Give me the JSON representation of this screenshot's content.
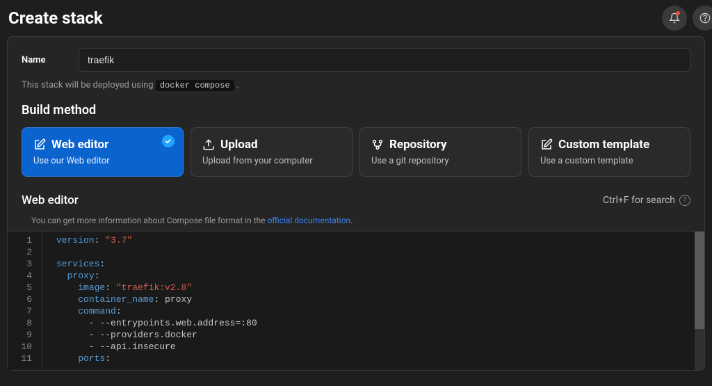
{
  "header": {
    "title": "Create stack"
  },
  "form": {
    "name_label": "Name",
    "name_value": "traefik",
    "deploy_note_prefix": "This stack will be deployed using",
    "deploy_note_cmd": "docker compose",
    "deploy_note_suffix": "."
  },
  "build": {
    "section_title": "Build method",
    "options": [
      {
        "icon": "edit-icon",
        "title": "Web editor",
        "sub": "Use our Web editor",
        "selected": true
      },
      {
        "icon": "upload-icon",
        "title": "Upload",
        "sub": "Upload from your computer",
        "selected": false
      },
      {
        "icon": "git-icon",
        "title": "Repository",
        "sub": "Use a git repository",
        "selected": false
      },
      {
        "icon": "edit-icon",
        "title": "Custom template",
        "sub": "Use a custom template",
        "selected": false
      }
    ]
  },
  "editor": {
    "title": "Web editor",
    "search_hint": "Ctrl+F for search",
    "info_prefix": "You can get more information about Compose file format in the ",
    "info_link": "official documentation",
    "info_suffix": ".",
    "lines": [
      {
        "n": 1,
        "tokens": [
          [
            "kw",
            "version"
          ],
          [
            "punc",
            ": "
          ],
          [
            "str",
            "\"3.7\""
          ]
        ]
      },
      {
        "n": 2,
        "tokens": []
      },
      {
        "n": 3,
        "tokens": [
          [
            "kw",
            "services"
          ],
          [
            "punc",
            ":"
          ]
        ]
      },
      {
        "n": 4,
        "tokens": [
          [
            "punc",
            "  "
          ],
          [
            "kw",
            "proxy"
          ],
          [
            "punc",
            ":"
          ]
        ]
      },
      {
        "n": 5,
        "tokens": [
          [
            "punc",
            "    "
          ],
          [
            "kw",
            "image"
          ],
          [
            "punc",
            ": "
          ],
          [
            "str",
            "\"traefik:v2.8\""
          ]
        ]
      },
      {
        "n": 6,
        "tokens": [
          [
            "punc",
            "    "
          ],
          [
            "kw",
            "container_name"
          ],
          [
            "punc",
            ": proxy"
          ]
        ]
      },
      {
        "n": 7,
        "tokens": [
          [
            "punc",
            "    "
          ],
          [
            "kw",
            "command"
          ],
          [
            "punc",
            ":"
          ]
        ]
      },
      {
        "n": 8,
        "tokens": [
          [
            "punc",
            "      - --entrypoints.web.address=:80"
          ]
        ]
      },
      {
        "n": 9,
        "tokens": [
          [
            "punc",
            "      - --providers.docker"
          ]
        ]
      },
      {
        "n": 10,
        "tokens": [
          [
            "punc",
            "      - --api.insecure"
          ]
        ]
      },
      {
        "n": 11,
        "tokens": [
          [
            "punc",
            "    "
          ],
          [
            "kw",
            "ports"
          ],
          [
            "punc",
            ":"
          ]
        ]
      }
    ]
  }
}
